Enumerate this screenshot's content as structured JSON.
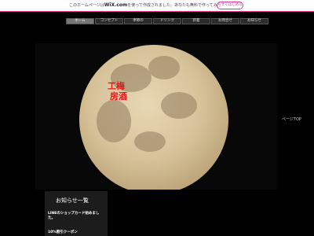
{
  "promo": {
    "text_prefix": "このホームページは",
    "brand": "WiX.com",
    "text_suffix": "を使って作成されました。あなたも無料で作ってみませんか？",
    "cta": "今すぐはじめる"
  },
  "nav": {
    "items": [
      {
        "label": "ホーム",
        "active": true
      },
      {
        "label": "コンセプト",
        "active": false
      },
      {
        "label": "季節の",
        "active": false
      },
      {
        "label": "ドリンク",
        "active": false
      },
      {
        "label": "新着",
        "active": false
      },
      {
        "label": "お問合せ",
        "active": false
      },
      {
        "label": "お知らせ",
        "active": false
      }
    ]
  },
  "hero": {
    "logo_line1": "工梅",
    "logo_line2": "房酒"
  },
  "side": {
    "page_top": "ページTOP"
  },
  "news": {
    "title": "お知らせ一覧",
    "item1": "LINEのショップカード始めました。",
    "item2": "10%割引クーポン"
  }
}
